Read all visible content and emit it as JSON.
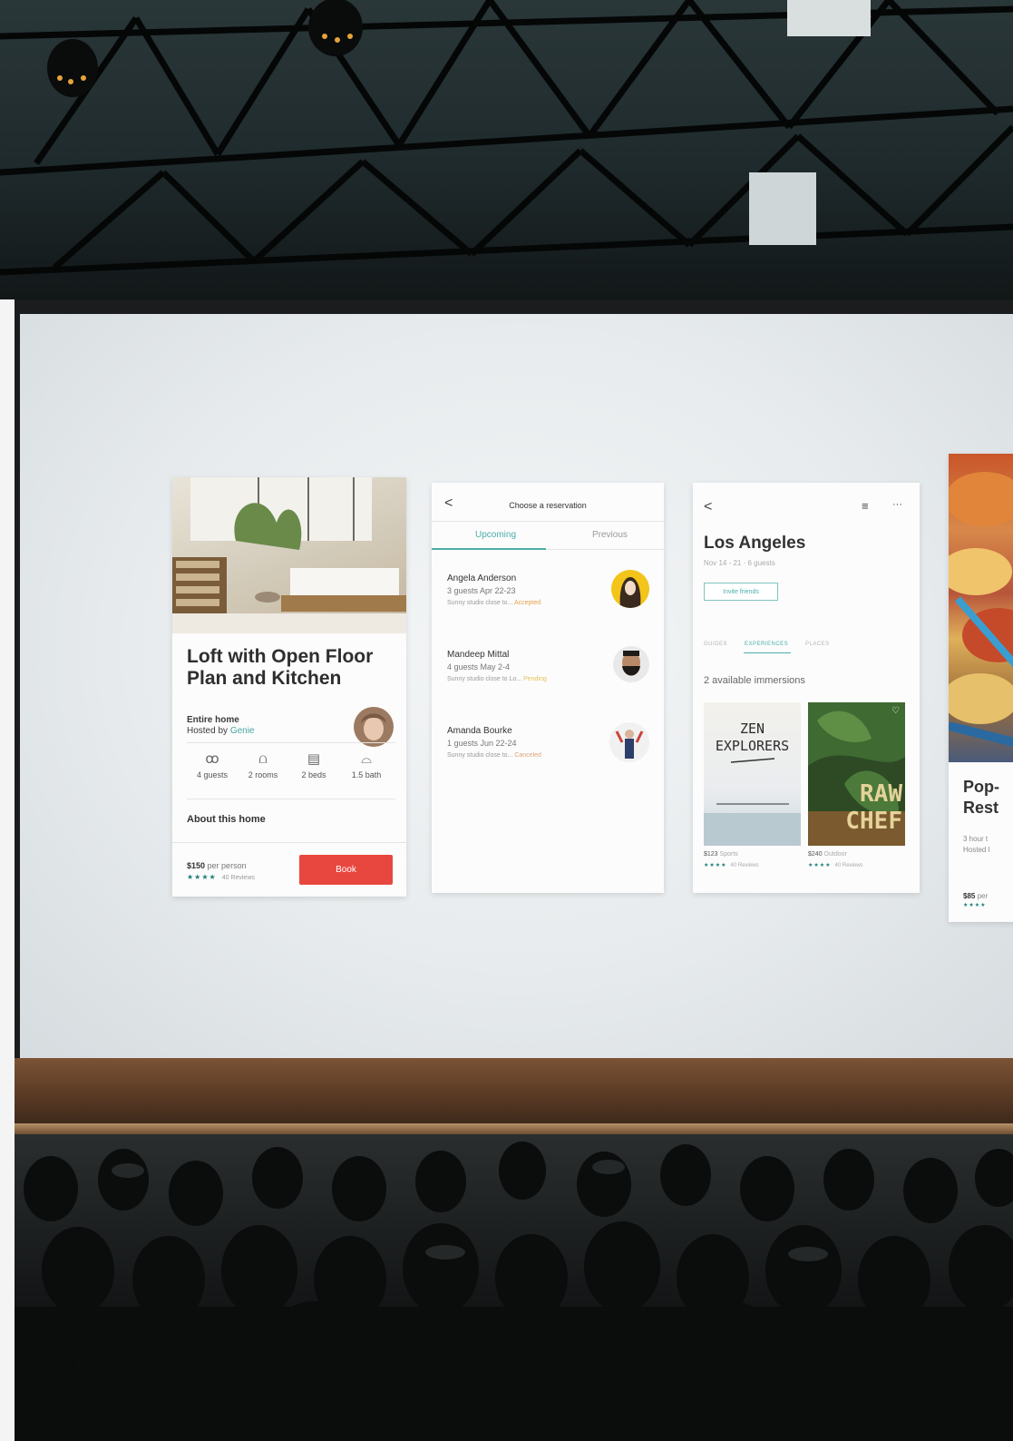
{
  "card_listing": {
    "title": "Loft with Open Floor Plan and Kitchen",
    "home_type": "Entire home",
    "hosted_by": "Hosted by",
    "host_name": "Genie",
    "amenities": [
      {
        "icon": "guests-icon",
        "glyph": "ꝏ",
        "label": "4 guests"
      },
      {
        "icon": "rooms-icon",
        "glyph": "⩍",
        "label": "2 rooms"
      },
      {
        "icon": "beds-icon",
        "glyph": "▤",
        "label": "2 beds"
      },
      {
        "icon": "bath-icon",
        "glyph": "⌓",
        "label": "1.5 bath"
      }
    ],
    "about_heading": "About this home",
    "price": "$150",
    "price_unit": "per person",
    "stars": "★★★★",
    "reviews": "40 Reviews",
    "book_label": "Book"
  },
  "card_reservations": {
    "header": "Choose a reservation",
    "back_glyph": "<",
    "tabs": [
      "Upcoming",
      "Previous"
    ],
    "active_tab": "Upcoming",
    "items": [
      {
        "name": "Angela Anderson",
        "details": "3 guests   Apr 22-23",
        "description": "Sunny studio close to... ",
        "status": "Accepted"
      },
      {
        "name": "Mandeep Mittal",
        "details": "4 guests   May 2-4",
        "description": "Sunny studio close to Lo... ",
        "status": "Pending"
      },
      {
        "name": "Amanda Bourke",
        "details": "1 guests   Jun 22-24",
        "description": "Sunny studio close to... ",
        "status": "Canceled"
      }
    ]
  },
  "card_trip": {
    "back_glyph": "<",
    "menu_glyph": "≡",
    "more_glyph": "···",
    "city": "Los Angeles",
    "dates": "Nov 14 - 21 · 6 guests",
    "invite_label": "Invite friends",
    "tabs": [
      "GUIDES",
      "EXPERIENCES",
      "PLACES"
    ],
    "active_tab": "EXPERIENCES",
    "available": "2 available immersions",
    "posters": [
      {
        "title_line1": "ZEN",
        "title_line2": "EXPLORERS",
        "price": "$123",
        "category": "Sports",
        "stars": "★★★★",
        "reviews": "40 Reviews"
      },
      {
        "title_line1": "RAW",
        "title_line2": "CHEF",
        "price": "$240",
        "category": "Outdoor",
        "stars": "★★★★",
        "reviews": "40 Reviews"
      }
    ]
  },
  "card_restaurant": {
    "title_line1": "Pop-",
    "title_line2": "Rest",
    "meta1": "3 hour t",
    "meta2": "Hosted l",
    "price": "$85",
    "price_unit": "per",
    "stars": "★★★★"
  },
  "colors": {
    "accent_teal": "#4aaea8",
    "book_red": "#e8473f"
  }
}
